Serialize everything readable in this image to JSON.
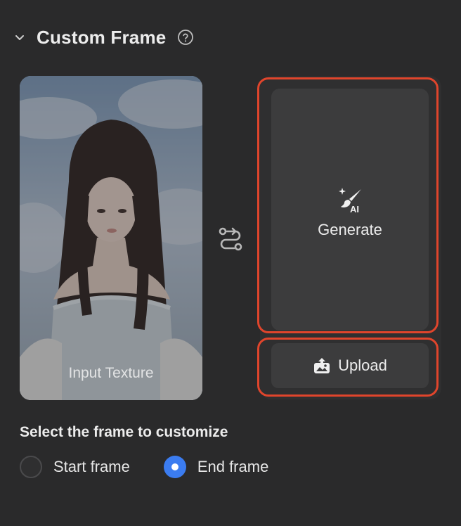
{
  "section": {
    "title": "Custom Frame",
    "collapse_icon": "chevron-down-icon",
    "help_icon": "help-circle-icon"
  },
  "texture": {
    "label": "Input Texture"
  },
  "swap_icon": "swap-icon",
  "generate": {
    "label": "Generate",
    "icon": "ai-brush-icon"
  },
  "upload": {
    "label": "Upload",
    "icon": "image-upload-icon"
  },
  "frame_select": {
    "heading": "Select the frame to customize",
    "options": [
      {
        "label": "Start frame",
        "selected": false
      },
      {
        "label": "End frame",
        "selected": true
      }
    ]
  },
  "colors": {
    "background": "#2a2a2b",
    "button": "#3c3c3d",
    "highlight_outline": "#e0452c",
    "radio_selected": "#3b7cf0"
  }
}
